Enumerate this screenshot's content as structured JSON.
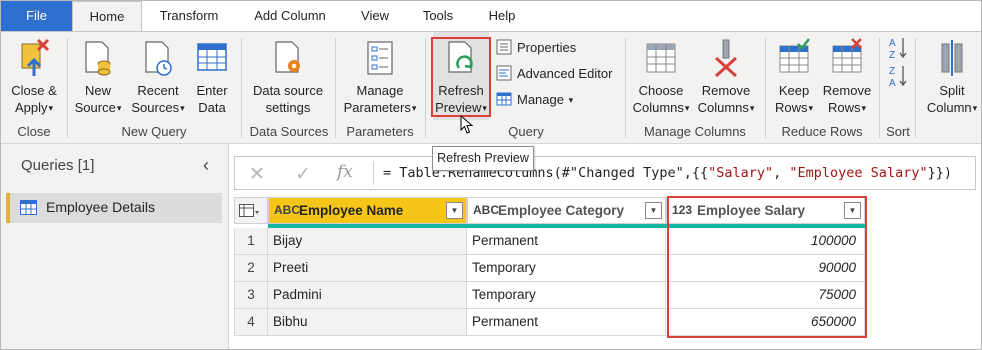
{
  "tabs": [
    "File",
    "Home",
    "Transform",
    "Add Column",
    "View",
    "Tools",
    "Help"
  ],
  "ribbon": {
    "close_apply": [
      "Close &",
      "Apply"
    ],
    "new_source": [
      "New",
      "Source"
    ],
    "recent_sources": [
      "Recent",
      "Sources"
    ],
    "enter_data": [
      "Enter",
      "Data"
    ],
    "data_source_settings": [
      "Data source",
      "settings"
    ],
    "manage_parameters": [
      "Manage",
      "Parameters"
    ],
    "refresh_preview": [
      "Refresh",
      "Preview"
    ],
    "properties": "Properties",
    "advanced_editor": "Advanced Editor",
    "manage": "Manage",
    "choose_columns": [
      "Choose",
      "Columns"
    ],
    "remove_columns": [
      "Remove",
      "Columns"
    ],
    "keep_rows": [
      "Keep",
      "Rows"
    ],
    "remove_rows": [
      "Remove",
      "Rows"
    ],
    "split_column": [
      "Split",
      "Column"
    ],
    "groups": [
      "Close",
      "New Query",
      "Data Sources",
      "Parameters",
      "Query",
      "Manage Columns",
      "Reduce Rows",
      "Sort"
    ]
  },
  "tooltip": "Refresh Preview",
  "queries": {
    "title": "Queries [1]",
    "items": [
      "Employee Details"
    ]
  },
  "formula": {
    "prefix": "= Table.RenameColumns(#\"Changed Type\",{{",
    "str1": "\"Salary\"",
    "mid": ", ",
    "str2": "\"Employee Salary\"",
    "suffix": "}})"
  },
  "table": {
    "columns": [
      {
        "type": "ABC",
        "name": "Employee Name"
      },
      {
        "type": "ABC",
        "name": "Employee Category"
      },
      {
        "type": "123",
        "name": "Employee Salary"
      }
    ],
    "rows": [
      {
        "n": "1",
        "name": "Bijay",
        "category": "Permanent",
        "salary": "100000"
      },
      {
        "n": "2",
        "name": "Preeti",
        "category": "Temporary",
        "salary": "90000"
      },
      {
        "n": "3",
        "name": "Padmini",
        "category": "Temporary",
        "salary": "75000"
      },
      {
        "n": "4",
        "name": "Bibhu",
        "category": "Permanent",
        "salary": "650000"
      }
    ]
  },
  "colors": {
    "file_tab": "#2f6fcd",
    "highlight": "#d9403a",
    "selected_header": "#f5c518",
    "column_quality_bar": "#17b3a3",
    "query_marker": "#e0b33a"
  }
}
